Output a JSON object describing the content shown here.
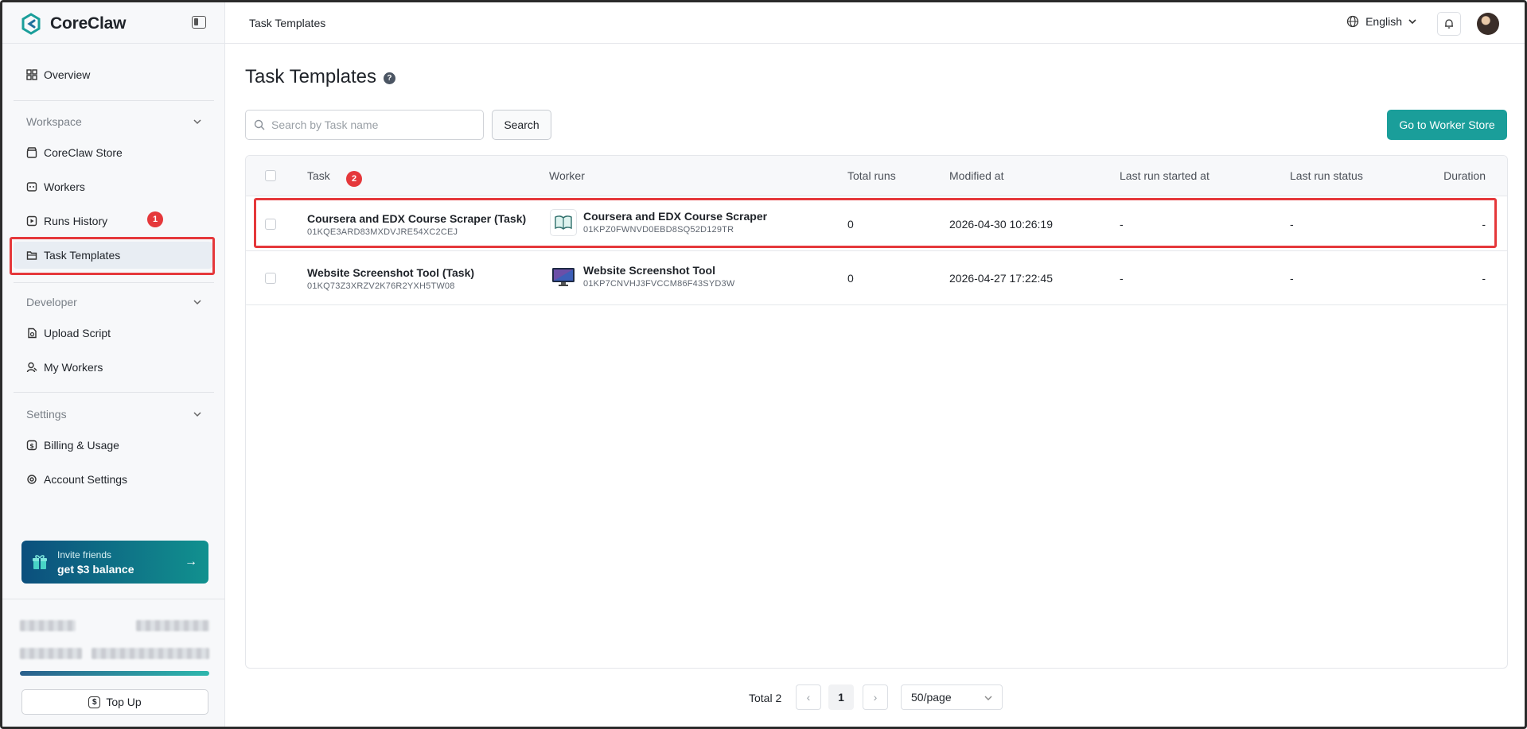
{
  "app": {
    "name": "CoreClaw",
    "brand_color": "#1a9e9a"
  },
  "sidebar": {
    "items_top": [
      {
        "label": "Overview",
        "icon": "grid-icon"
      }
    ],
    "workspace": {
      "label": "Workspace",
      "items": [
        {
          "label": "CoreClaw Store",
          "icon": "store-icon"
        },
        {
          "label": "Workers",
          "icon": "workers-icon"
        },
        {
          "label": "Runs History",
          "icon": "play-icon"
        },
        {
          "label": "Task Templates",
          "icon": "folder-icon",
          "active": true
        }
      ]
    },
    "developer": {
      "label": "Developer",
      "items": [
        {
          "label": "Upload Script",
          "icon": "upload-icon"
        },
        {
          "label": "My Workers",
          "icon": "user-icon"
        }
      ]
    },
    "settings": {
      "label": "Settings",
      "items": [
        {
          "label": "Billing & Usage",
          "icon": "dollar-icon"
        },
        {
          "label": "Account Settings",
          "icon": "gear-icon"
        }
      ]
    },
    "invite": {
      "line1": "Invite friends",
      "line2": "get $3 balance"
    },
    "topup_label": "Top Up"
  },
  "annotations": {
    "badge1": "1",
    "badge2": "2",
    "highlight_color": "#e5383b"
  },
  "header": {
    "breadcrumb": "Task Templates",
    "language": "English"
  },
  "main": {
    "title": "Task Templates",
    "help": "?",
    "search": {
      "placeholder": "Search by Task name",
      "value": "",
      "button": "Search"
    },
    "store_button": "Go to Worker Store",
    "table": {
      "columns": [
        "Task",
        "Worker",
        "Total runs",
        "Modified at",
        "Last run started at",
        "Last run status",
        "Duration"
      ],
      "rows": [
        {
          "task_name": "Coursera and EDX Course Scraper (Task)",
          "task_id": "01KQE3ARD83MXDVJRE54XC2CEJ",
          "worker_name": "Coursera and EDX Course Scraper",
          "worker_id": "01KPZ0FWNVD0EBD8SQ52D129TR",
          "worker_icon": "book-icon",
          "total_runs": "0",
          "modified_at": "2026-04-30 10:26:19",
          "last_started": "-",
          "last_status": "-",
          "duration": "-"
        },
        {
          "task_name": "Website Screenshot Tool (Task)",
          "task_id": "01KQ73Z3XRZV2K76R2YXH5TW08",
          "worker_name": "Website Screenshot Tool",
          "worker_id": "01KP7CNVHJ3FVCCM86F43SYD3W",
          "worker_icon": "monitor-icon",
          "total_runs": "0",
          "modified_at": "2026-04-27 17:22:45",
          "last_started": "-",
          "last_status": "-",
          "duration": "-"
        }
      ]
    },
    "pagination": {
      "total": "Total 2",
      "current": "1",
      "page_size": "50/page",
      "prev": "‹",
      "next": "›"
    }
  }
}
